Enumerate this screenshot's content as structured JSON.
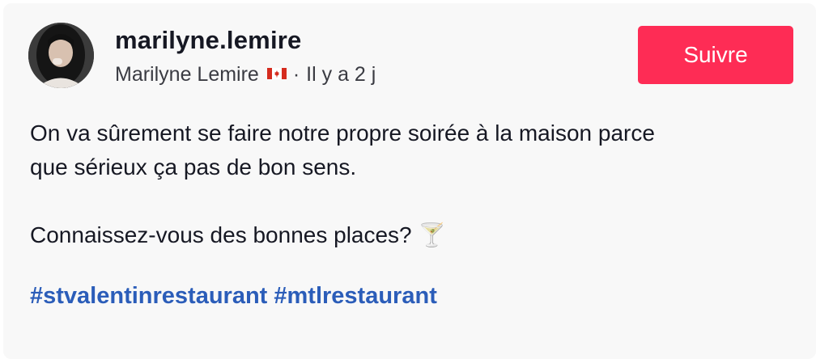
{
  "post": {
    "username": "marilyne.lemire",
    "display_name": "Marilyne Lemire",
    "flag_icon": "canada-flag-icon",
    "time_sep": "·",
    "time_ago": "Il y a 2 j",
    "follow_label": "Suivre",
    "caption_line1": "On va sûrement se faire notre propre soirée à la maison parce",
    "caption_line2": "que sérieux ça pas de bon sens.",
    "caption_line3": "Connaissez-vous des bonnes places? 🍸",
    "hashtags": [
      "#stvalentinrestaurant",
      "#mtlrestaurant"
    ]
  },
  "colors": {
    "follow_button": "#fe2c55",
    "hashtag": "#2b5db9",
    "card_background": "#f8f8f8"
  }
}
